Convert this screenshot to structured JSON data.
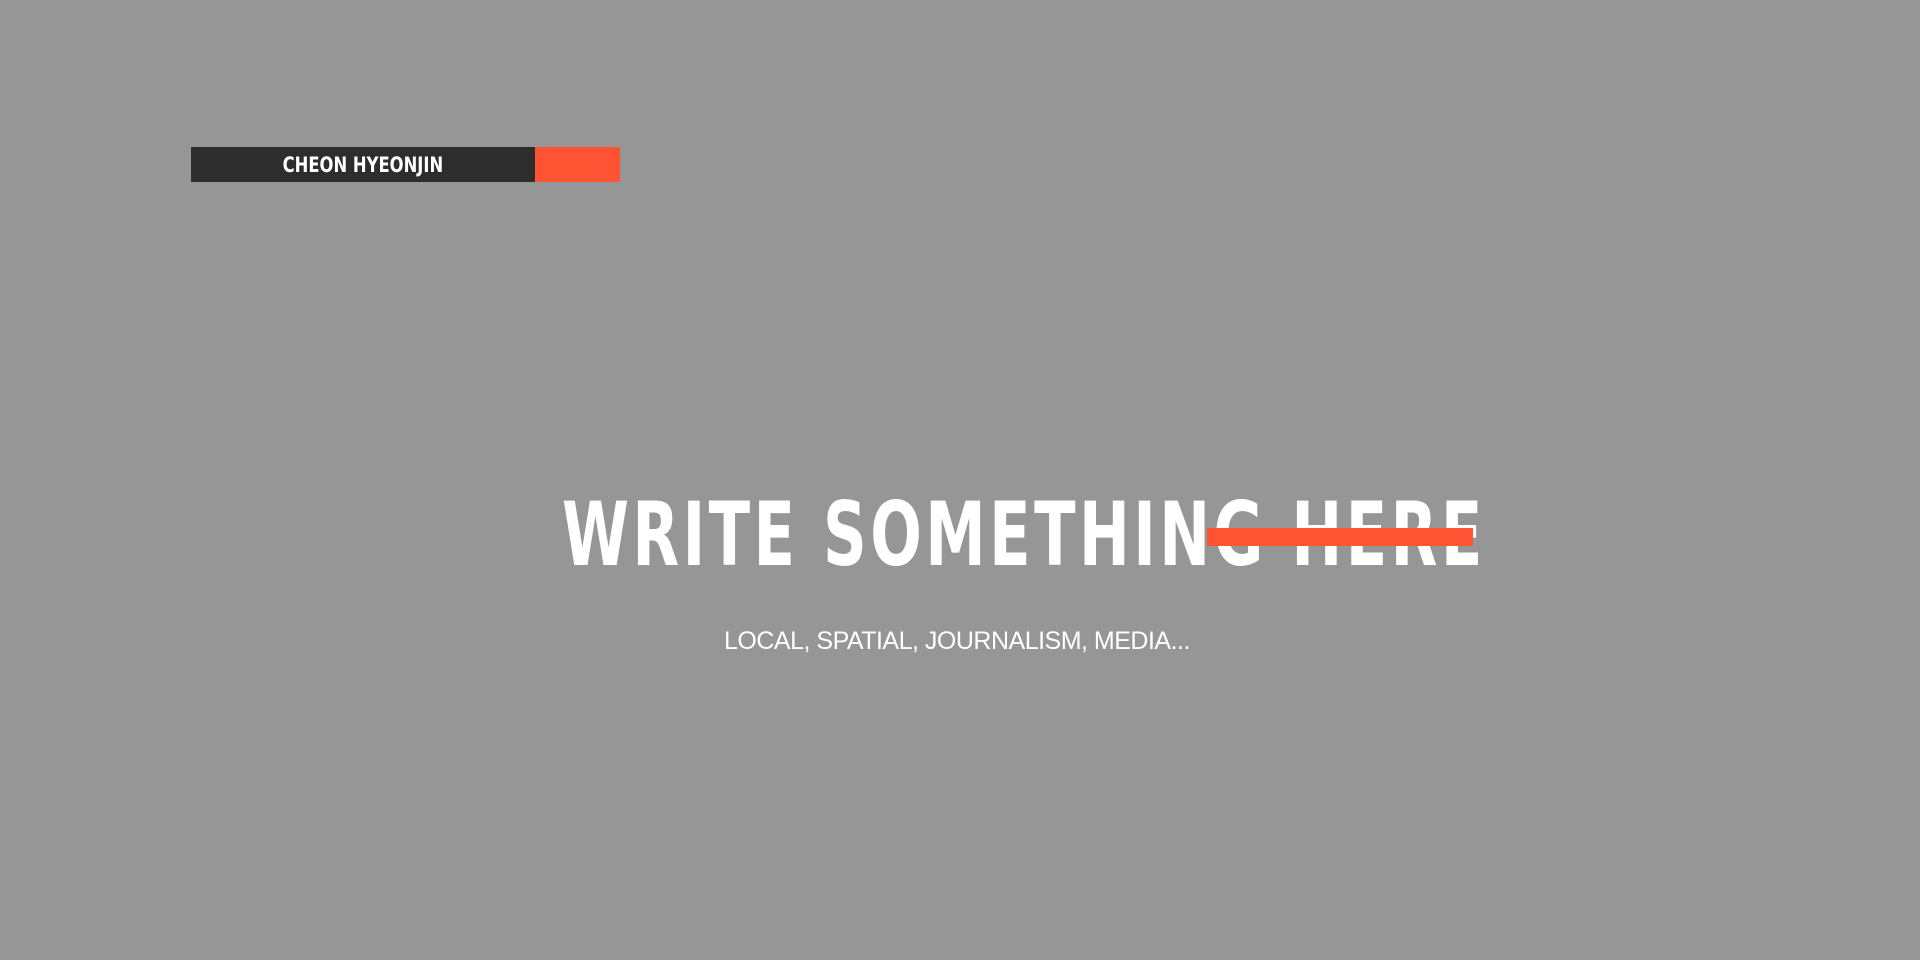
{
  "brand": {
    "name": "CHEON HYEONJIN"
  },
  "hero": {
    "headline": "WRITE SOMETHING HERE",
    "subtitle": "LOCAL, SPATIAL, JOURNALISM, MEDIA..."
  },
  "colors": {
    "background": "#969696",
    "brand_dark": "#2d2d2d",
    "accent": "#ff5433",
    "text": "#ffffff"
  }
}
